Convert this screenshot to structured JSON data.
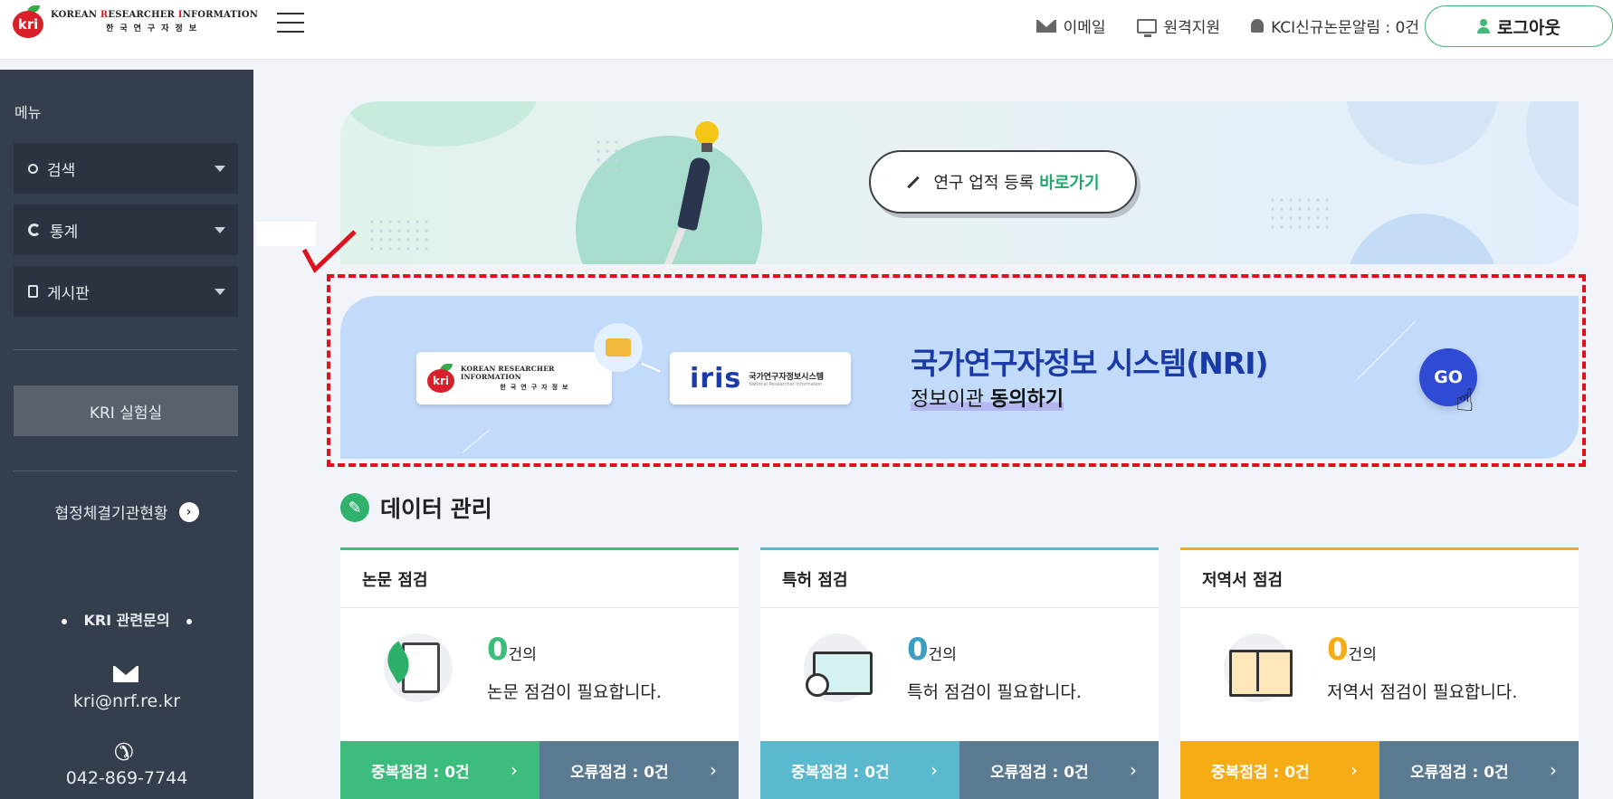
{
  "header": {
    "logo_en_first": "K",
    "logo_en_rest1": "OREAN ",
    "logo_en_r": "R",
    "logo_en_rest2": "ESEARCHER ",
    "logo_en_i": "I",
    "logo_en_rest3": "NFORMATION",
    "logo_ko": "한국연구자정보",
    "logo_badge": "kri",
    "links": {
      "email": "이메일",
      "remote": "원격지원",
      "kci_alert": "KCI신규논문알림 : 0건"
    },
    "logout_label": "로그아웃"
  },
  "sidebar": {
    "menu_title": "메뉴",
    "items": [
      {
        "label": "검색",
        "icon": "search-icon"
      },
      {
        "label": "통계",
        "icon": "chart-icon"
      },
      {
        "label": "게시판",
        "icon": "board-icon"
      }
    ],
    "lab_label": "KRI 실험실",
    "partner_label": "협정체결기관현황",
    "inquiry_label": "KRI 관련문의",
    "email": "kri@nrf.re.kr",
    "phone": "042-869-7744"
  },
  "top_banner": {
    "button_prefix": "연구 업적 등록",
    "button_strong": "바로가기"
  },
  "nri_banner": {
    "kri_logo_badge": "kri",
    "kri_logo_en": "KOREAN RESEARCHER INFORMATION",
    "kri_logo_ko": "한국연구자정보",
    "iris_word": "iris",
    "iris_ko": "국가연구자정보시스템",
    "iris_en": "National Researcher Information",
    "title": "국가연구자정보 시스템(NRI)",
    "subtitle_prefix": "정보이관 ",
    "subtitle_strong": "동의하기",
    "go_label": "GO"
  },
  "data_section": {
    "title": "데이터 관리",
    "cards": [
      {
        "title": "논문 점검",
        "count": "0",
        "count_suffix": "건의",
        "desc": "논문 점검이 필요합니다.",
        "dup_label": "중복점검 : 0건",
        "err_label": "오류점검 : 0건",
        "accent": "#3dbd7d"
      },
      {
        "title": "특허 점검",
        "count": "0",
        "count_suffix": "건의",
        "desc": "특허 점검이 필요합니다.",
        "dup_label": "중복점검 : 0건",
        "err_label": "오류점검 : 0건",
        "accent": "#5ab8cf"
      },
      {
        "title": "저역서 점검",
        "count": "0",
        "count_suffix": "건의",
        "desc": "저역서 점검이 필요합니다.",
        "dup_label": "중복점검 : 0건",
        "err_label": "오류점검 : 0건",
        "accent": "#f6ad15"
      }
    ]
  },
  "colors": {
    "sidebar_bg": "#343e4d",
    "brand_green": "#1fa96a",
    "nri_blue": "#1a3aa8",
    "highlight_red": "#e0111f"
  }
}
